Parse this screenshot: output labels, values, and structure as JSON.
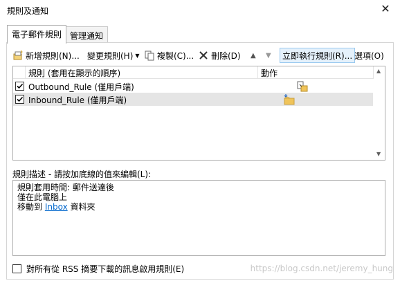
{
  "window": {
    "title": "規則及通知"
  },
  "tabs": [
    {
      "label": "電子郵件規則"
    },
    {
      "label": "管理通知"
    }
  ],
  "toolbar": {
    "new_rule": "新增規則(N)...",
    "change_rule": "變更規則(H)",
    "copy": "複製(C)...",
    "delete": "刪除(D)",
    "run_rules": "立即執行規則(R)...",
    "options": "選項(O)"
  },
  "rules_table": {
    "columns": [
      "規則 (套用在顯示的順序)",
      "動作"
    ],
    "rows": [
      {
        "label": "Outbound_Rule  (僅用戶端)",
        "checked": true,
        "selected": false
      },
      {
        "label": "Inbound_Rule  (僅用戶端)",
        "checked": true,
        "selected": true
      }
    ]
  },
  "description": {
    "label": "規則描述 - 請按加底線的值來編輯(L):",
    "lines": [
      "規則套用時間: 郵件送達後",
      "僅在此電腦上"
    ],
    "move_prefix": "移動到 ",
    "move_link": "Inbox",
    "move_suffix": " 資料夾"
  },
  "rss_option": {
    "label": "對所有從 RSS 摘要下載的訊息啟用規則(E)"
  },
  "watermark": "https://blog.csdn.net/jeremy_hung",
  "colors": {
    "link": "#0066cc",
    "selected_row": "#e5e5e5",
    "hover": "#e5f1fb"
  }
}
